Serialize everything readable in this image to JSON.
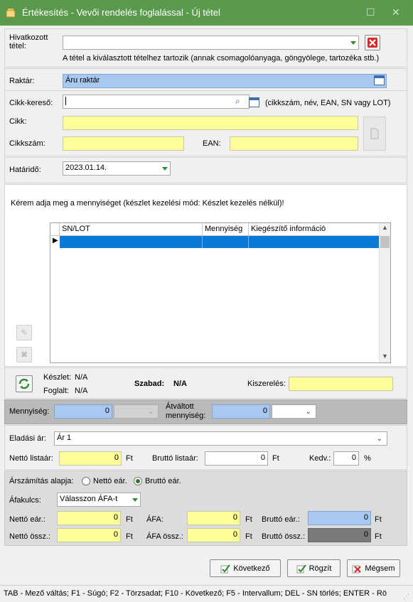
{
  "window": {
    "title": "Értékesítés - Vevői rendelés foglalással - Új tétel"
  },
  "parent_item": {
    "label": "Hivatkozott tétel:",
    "value": "",
    "note": "A tétel a kiválasztott tételhez tartozik (annak csomagolóanyaga, göngyölege, tartozéka stb.)"
  },
  "warehouse": {
    "label": "Raktár:",
    "value": "Áru raktár"
  },
  "item": {
    "search_label": "Cikk-kereső:",
    "search_value": "",
    "search_hint": "(cikkszám, név, EAN, SN vagy LOT)",
    "name_label": "Cikk:",
    "name_value": "",
    "code_label": "Cikkszám:",
    "code_value": "",
    "ean_label": "EAN:",
    "ean_value": ""
  },
  "deadline": {
    "label": "Határidő:",
    "value": "2023.01.14."
  },
  "quantity_prompt": "Kérem adja meg a mennyiséget (készlet kezelési mód: Készlet kezelés nélkül)!",
  "lot_grid": {
    "columns": [
      "SN/LOT",
      "Mennyiség",
      "Kiegészítő információ"
    ],
    "rows": [
      {
        "sn": "",
        "qty": "",
        "info": ""
      }
    ]
  },
  "stock": {
    "stock_label": "Készlet:",
    "stock_value": "N/A",
    "reserved_label": "Foglalt:",
    "reserved_value": "N/A",
    "free_label": "Szabad:",
    "free_value": "N/A",
    "packaging_label": "Kiszerelés:",
    "packaging_value": ""
  },
  "quantity": {
    "label": "Mennyiség:",
    "value": "0",
    "unit": "",
    "converted_label_1": "Átváltott",
    "converted_label_2": "mennyiség:",
    "converted_value": "0",
    "converted_unit": ""
  },
  "price": {
    "label": "Eladási ár:",
    "value": "Ár 1",
    "net_list_label": "Nettó listaár:",
    "net_list_value": "0",
    "net_list_unit": "Ft",
    "gross_list_label": "Bruttó listaár:",
    "gross_list_value": "0",
    "gross_list_unit": "Ft",
    "discount_label": "Kedv.:",
    "discount_value": "0",
    "discount_unit": "%"
  },
  "calc": {
    "basis_label": "Árszámítás alapja:",
    "net_option": "Nettó eár.",
    "gross_option": "Bruttó eár.",
    "selected": "gross",
    "vat_label": "Áfakulcs:",
    "vat_value": "Válasszon ÁFA-t",
    "net_unit_label": "Nettó eár.:",
    "net_unit_value": "0",
    "vat_amt_label": "ÁFA:",
    "vat_amt_value": "0",
    "gross_unit_label": "Bruttó eár.:",
    "gross_unit_value": "0",
    "net_total_label": "Nettó össz.:",
    "net_total_value": "0",
    "vat_total_label": "ÁFA össz.:",
    "vat_total_value": "0",
    "gross_total_label": "Bruttó össz.:",
    "gross_total_value": "0",
    "currency": "Ft"
  },
  "buttons": {
    "next": "Következő",
    "save": "Rögzít",
    "cancel": "Mégsem"
  },
  "statusbar": "TAB - Mező váltás; F1 - Súgó; F2 - Törzsadat; F10 - Következő; F5 - Intervallum; DEL - SN törlés; ENTER - Rö",
  "colors": {
    "titlebar": "#5a9a4c",
    "selection": "#0a78d7",
    "yellow_field": "#ffff99",
    "blue_field": "#a8c8f0"
  }
}
